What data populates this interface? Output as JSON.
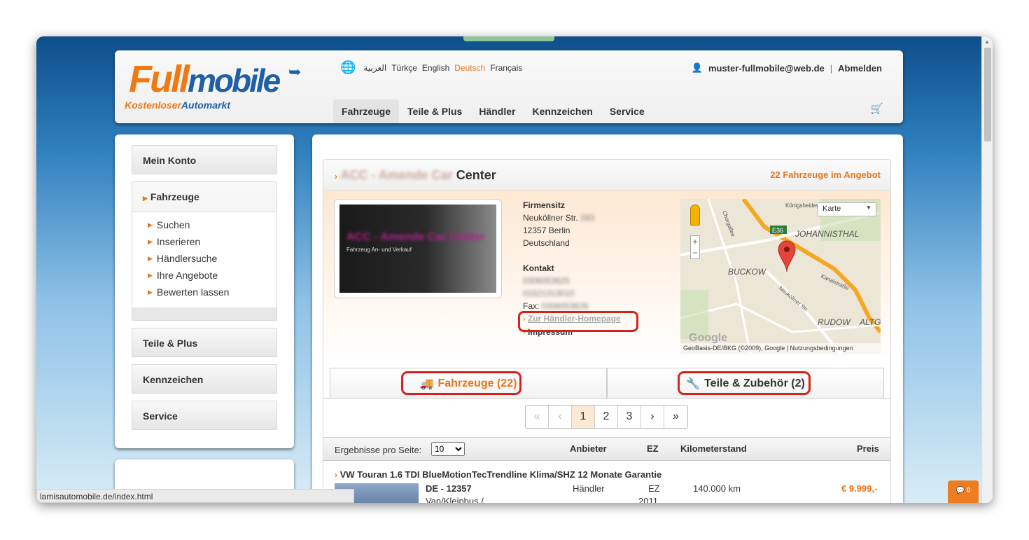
{
  "header": {
    "logo_main": "Full",
    "logo_main2": "mobile",
    "logo_tagline_a": "Kostenloser",
    "logo_tagline_b": "Automarkt",
    "languages": [
      "العربية",
      "Türkçe",
      "English",
      "Deutsch",
      "Français"
    ],
    "active_language": "Deutsch",
    "user_email": "muster-fullmobile@web.de",
    "separator": "|",
    "logout": "Abmelden",
    "nav": [
      "Fahrzeuge",
      "Teile & Plus",
      "Händler",
      "Kennzeichen",
      "Service"
    ],
    "active_nav": "Fahrzeuge"
  },
  "sidebar": {
    "account": "Mein Konto",
    "vehicles": "Fahrzeuge",
    "vehicle_items": [
      "Suchen",
      "Inserieren",
      "Händlersuche",
      "Ihre Angebote",
      "Bewerten lassen"
    ],
    "parts": "Teile & Plus",
    "plates": "Kennzeichen",
    "service": "Service"
  },
  "dealer": {
    "name_blurred": "ACC - Amende Car",
    "name_visible": "Center",
    "offers": "22 Fahrzeuge im Angebot",
    "banner_title": "ACC - Amende Car Center",
    "banner_subtitle": "Fahrzeug An- und Verkauf",
    "hq_label": "Firmensitz",
    "street": "Neuköllner Str.",
    "street_no": "283",
    "city": "12357 Berlin",
    "country": "Deutschland",
    "contact_label": "Kontakt",
    "phone1": "0306053625",
    "phone2": "01521313010",
    "fax_label": "Fax:",
    "fax": "0306053626",
    "homepage_link": "Zur Händler-Homepage",
    "imprint_link": "Impressum"
  },
  "map": {
    "type_select": "Karte",
    "labels": [
      "JOHANNISTHAL",
      "BUCKOW",
      "RUDOW",
      "ALTG",
      "E36",
      "Königsheideweg",
      "Chorgallee",
      "Neuköllner Str.",
      "Kanalstraße"
    ],
    "attribution": "GeoBasis-DE/BKG (©2009), Google",
    "terms": "Nutzungsbedingungen",
    "zoom_in": "+",
    "zoom_out": "−"
  },
  "tabs": {
    "vehicles": "Fahrzeuge (22)",
    "parts": "Teile & Zubehör (2)"
  },
  "pager": {
    "first": "«",
    "prev": "‹",
    "pages": [
      "1",
      "2",
      "3"
    ],
    "current": "1",
    "next": "›",
    "last": "»"
  },
  "results": {
    "per_page_label": "Ergebnisse pro Seite:",
    "per_page_value": "10",
    "columns": [
      "Anbieter",
      "EZ",
      "Kilometerstand",
      "Preis"
    ],
    "rows": [
      {
        "title": "VW Touran 1.6 TDI BlueMotionTecTrendline Klima/SHZ 12 Monate Garantie",
        "location": "DE - 12357",
        "category": "Van/Kleinbus /",
        "seller": "Händler",
        "ez_label": "EZ",
        "ez_year": "2011",
        "mileage": "140.000 km",
        "price": "€ 9.999,-"
      }
    ]
  },
  "status_url": "lamisautomobile.de/index.html",
  "chat_count": "0"
}
